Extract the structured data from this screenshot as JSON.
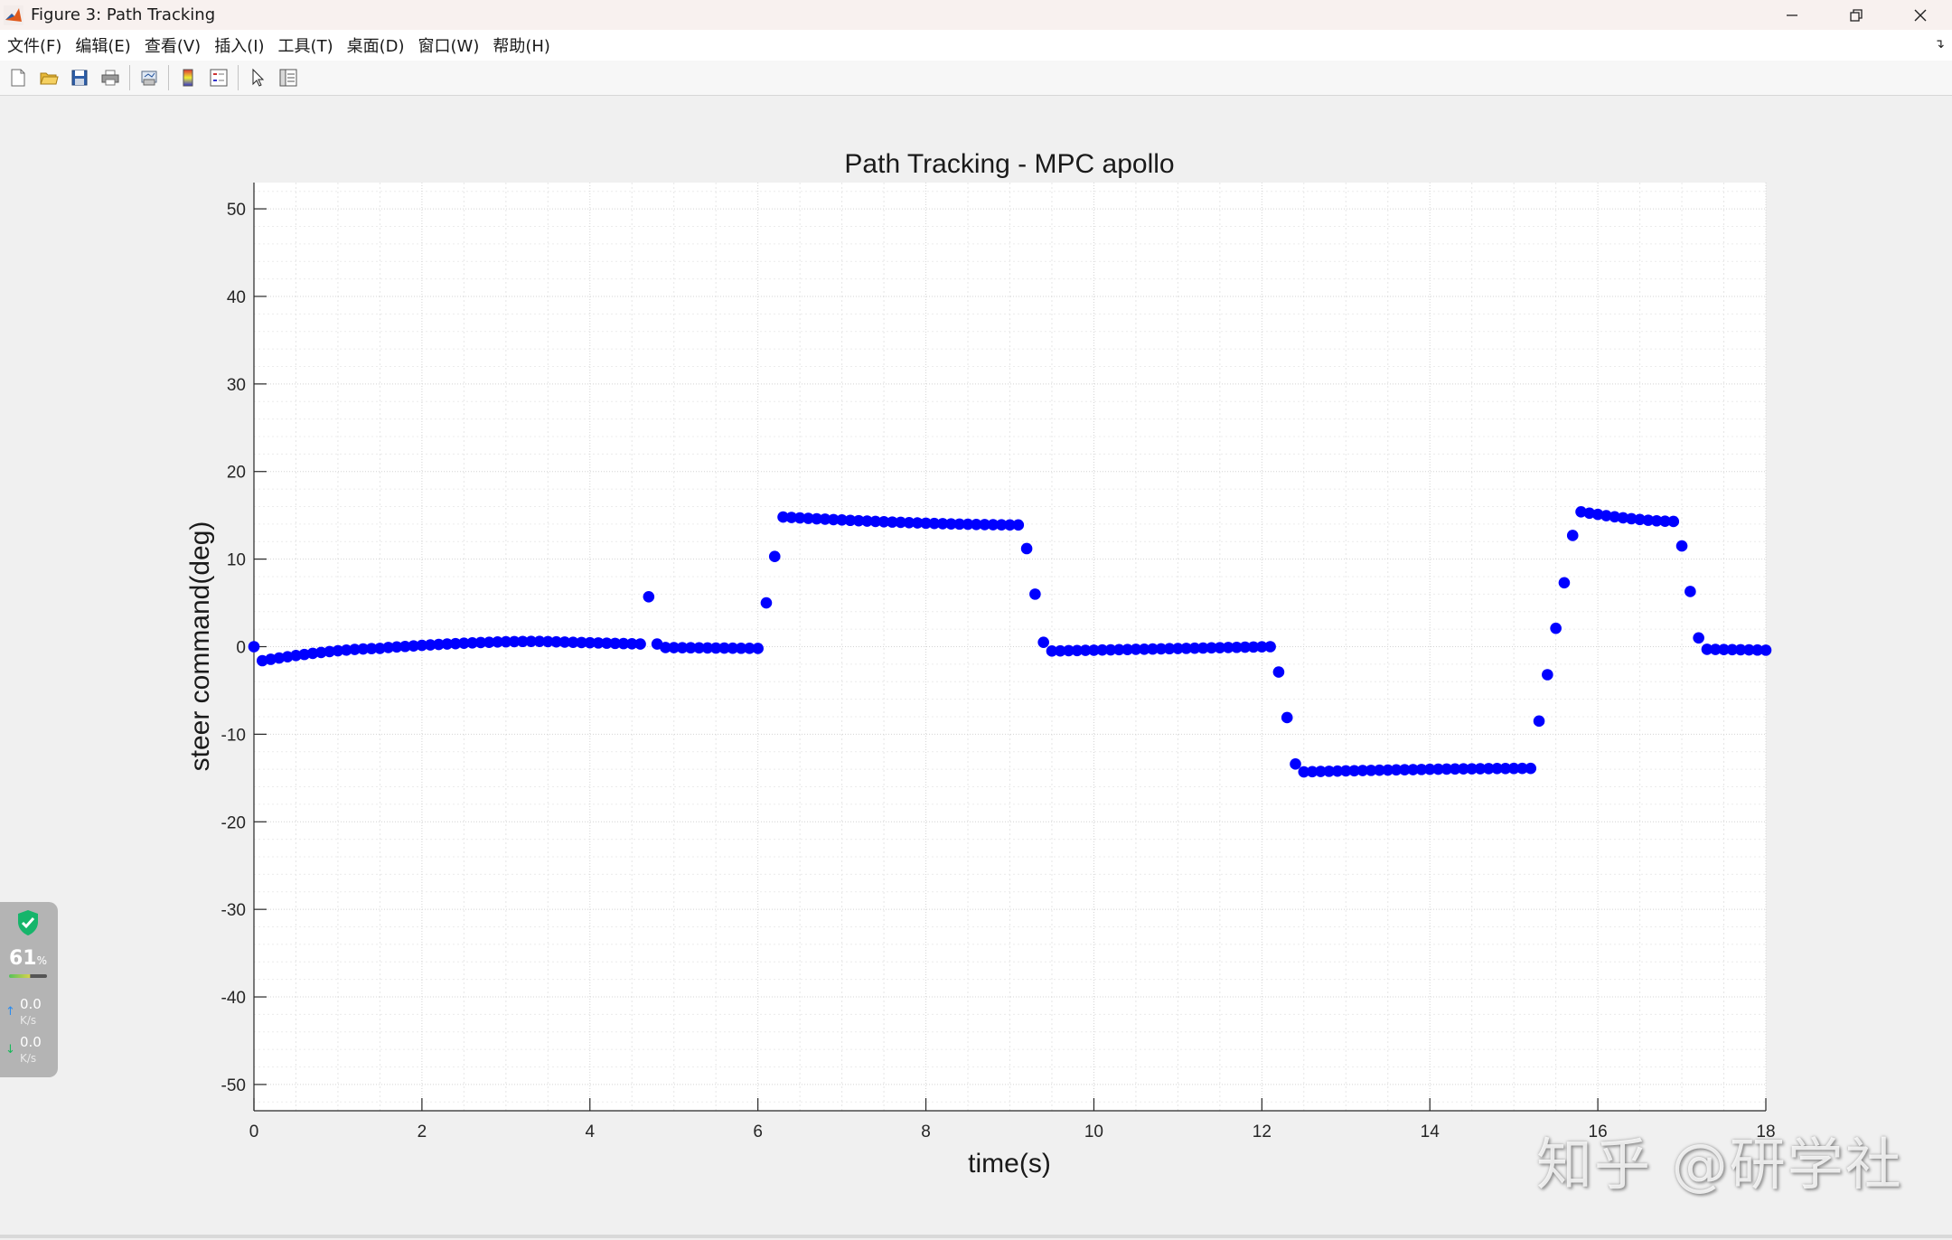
{
  "window": {
    "title": "Figure 3: Path Tracking"
  },
  "menu": [
    "文件(F)",
    "编辑(E)",
    "查看(V)",
    "插入(I)",
    "工具(T)",
    "桌面(D)",
    "窗口(W)",
    "帮助(H)"
  ],
  "toolbar": {
    "icons": [
      "new-figure-icon",
      "open-file-icon",
      "save-icon",
      "print-icon",
      "link-plot-icon",
      "insert-colorbar-icon",
      "insert-legend-icon",
      "edit-plot-icon",
      "property-inspector-icon"
    ]
  },
  "chart_data": {
    "type": "scatter",
    "title": "Path Tracking - MPC apollo",
    "xlabel": "time(s)",
    "ylabel": "steer command(deg)",
    "xlim": [
      0,
      18
    ],
    "ylim": [
      -53,
      53
    ],
    "xticks": [
      "0",
      "2",
      "4",
      "6",
      "8",
      "10",
      "12",
      "14",
      "16",
      "18"
    ],
    "yticks": [
      "-50",
      "-40",
      "-30",
      "-20",
      "-10",
      "0",
      "10",
      "20",
      "30",
      "40",
      "50"
    ],
    "grid": "major and minor, dotted",
    "marker_color": "#0000ff",
    "series": [
      {
        "segments": [
          {
            "t0": 0.0,
            "t1": 0.0,
            "v0": 0.0,
            "v1": 0.0
          },
          {
            "t0": 0.1,
            "t1": 1.5,
            "v0": -1.6,
            "v1": -0.2,
            "curve": 0.5
          },
          {
            "t0": 1.6,
            "t1": 3.3,
            "v0": -0.1,
            "v1": 0.6,
            "curve": 0.6
          },
          {
            "t0": 3.4,
            "t1": 4.6,
            "v0": 0.6,
            "v1": 0.3
          },
          {
            "t0": 4.7,
            "t1": 4.7,
            "v0": 5.7,
            "v1": 5.7
          },
          {
            "t0": 4.8,
            "t1": 4.8,
            "v0": 0.3,
            "v1": 0.3
          },
          {
            "t0": 4.9,
            "t1": 6.0,
            "v0": -0.1,
            "v1": -0.2
          },
          {
            "t0": 6.1,
            "t1": 6.1,
            "v0": 5.0,
            "v1": 5.0
          },
          {
            "t0": 6.2,
            "t1": 6.2,
            "v0": 10.3,
            "v1": 10.3
          },
          {
            "t0": 6.3,
            "t1": 9.1,
            "v0": 14.8,
            "v1": 13.9,
            "curve": 1.2
          },
          {
            "t0": 9.2,
            "t1": 9.2,
            "v0": 11.2,
            "v1": 11.2
          },
          {
            "t0": 9.3,
            "t1": 9.3,
            "v0": 6.0,
            "v1": 6.0
          },
          {
            "t0": 9.4,
            "t1": 9.4,
            "v0": 0.5,
            "v1": 0.5
          },
          {
            "t0": 9.5,
            "t1": 12.1,
            "v0": -0.5,
            "v1": 0.0
          },
          {
            "t0": 12.2,
            "t1": 12.2,
            "v0": -2.9,
            "v1": -2.9
          },
          {
            "t0": 12.3,
            "t1": 12.3,
            "v0": -8.1,
            "v1": -8.1
          },
          {
            "t0": 12.4,
            "t1": 12.4,
            "v0": -13.4,
            "v1": -13.4
          },
          {
            "t0": 12.5,
            "t1": 15.2,
            "v0": -14.3,
            "v1": -13.9,
            "curve": 0.7
          },
          {
            "t0": 15.3,
            "t1": 15.3,
            "v0": -8.5,
            "v1": -8.5
          },
          {
            "t0": 15.4,
            "t1": 15.4,
            "v0": -3.2,
            "v1": -3.2
          },
          {
            "t0": 15.5,
            "t1": 15.5,
            "v0": 2.1,
            "v1": 2.1
          },
          {
            "t0": 15.6,
            "t1": 15.6,
            "v0": 7.3,
            "v1": 7.3
          },
          {
            "t0": 15.7,
            "t1": 15.7,
            "v0": 12.7,
            "v1": 12.7
          },
          {
            "t0": 15.8,
            "t1": 16.9,
            "v0": 15.4,
            "v1": 14.3,
            "curve": 1.3
          },
          {
            "t0": 17.0,
            "t1": 17.0,
            "v0": 11.5,
            "v1": 11.5
          },
          {
            "t0": 17.1,
            "t1": 17.1,
            "v0": 6.3,
            "v1": 6.3
          },
          {
            "t0": 17.2,
            "t1": 17.2,
            "v0": 1.0,
            "v1": 1.0
          },
          {
            "t0": 17.3,
            "t1": 18.0,
            "v0": -0.3,
            "v1": -0.4
          }
        ],
        "step": 0.1
      }
    ]
  },
  "widget": {
    "percent": "61",
    "percent_unit": "%",
    "up_rate": "0.0",
    "up_unit": "K/s",
    "down_rate": "0.0",
    "down_unit": "K/s"
  },
  "watermark": "知乎 @研学社"
}
